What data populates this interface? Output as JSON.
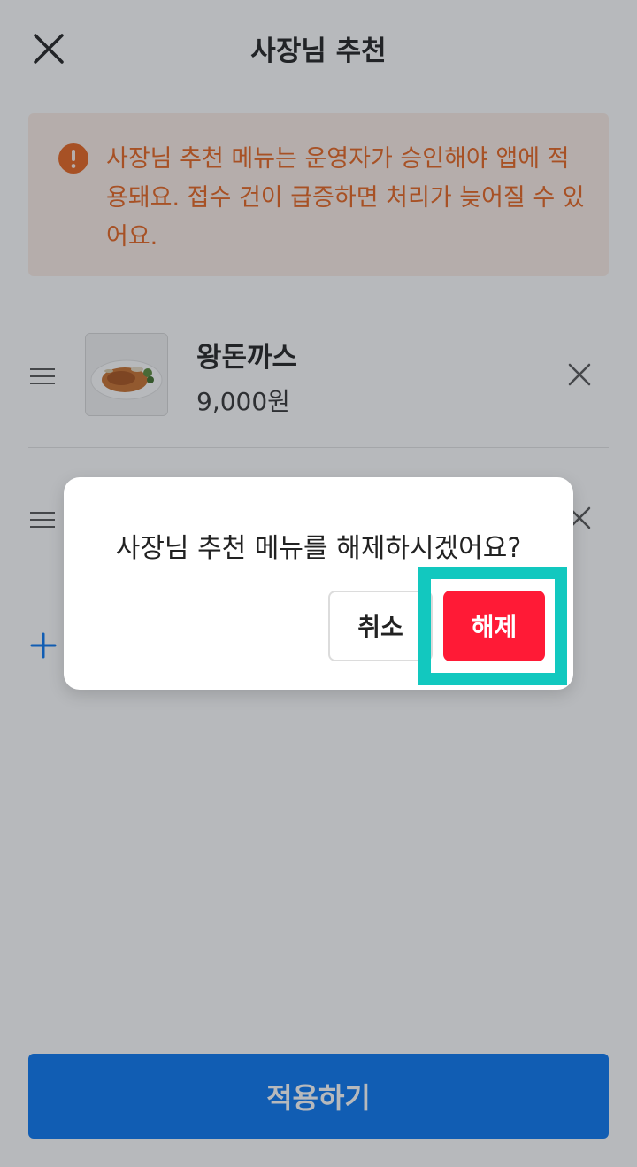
{
  "header": {
    "title": "사장님 추천",
    "close_icon": "close-icon"
  },
  "notice": {
    "icon": "exclamation-circle-icon",
    "text": "사장님 추천 메뉴는 운영자가 승인해야 앱에 적용돼요. 접수 건이 급증하면 처리가 늦어질 수 있어요.",
    "color": "#e8641e"
  },
  "menu": {
    "items": [
      {
        "name": "왕돈까스",
        "price": "9,000원",
        "image": "pork-cutlet-photo"
      }
    ]
  },
  "footer": {
    "apply_label": "적용하기",
    "accent_color": "#0877f2"
  },
  "dialog": {
    "message": "사장님 추천 메뉴를 해제하시겠어요?",
    "cancel_label": "취소",
    "confirm_label": "해제",
    "confirm_color": "#ff1a36",
    "highlight_color": "#12c8bf"
  }
}
